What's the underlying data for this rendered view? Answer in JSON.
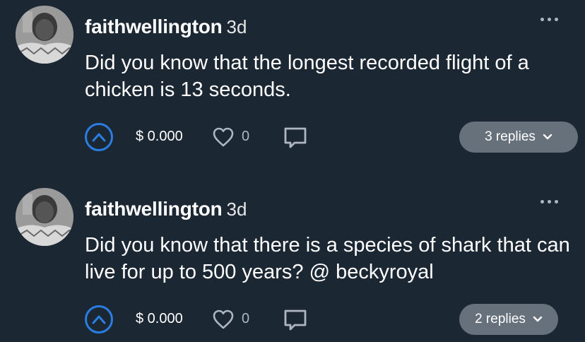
{
  "posts": [
    {
      "username": "faithwellington",
      "time": "3d",
      "text": "Did you know that the longest recorded flight of a chicken is 13 seconds.",
      "amount": "$ 0.000",
      "likes": "0",
      "replies": "3 replies",
      "icons": {
        "upvote": "chevron-up-icon",
        "like": "heart-outline-icon",
        "comment": "comment-icon",
        "more": "more-horizontal-icon",
        "replies": "chevron-down-icon"
      }
    },
    {
      "username": "faithwellington",
      "time": "3d",
      "text": "Did you know that there is a species of shark that can live for up to 500 years? @ beckyroyal",
      "amount": "$ 0.000",
      "likes": "0",
      "replies": "2 replies",
      "icons": {
        "upvote": "chevron-up-icon",
        "like": "heart-outline-icon",
        "comment": "comment-icon",
        "more": "more-horizontal-icon",
        "replies": "chevron-down-icon"
      }
    }
  ],
  "colors": {
    "background": "#1c2734",
    "accent": "#2a7de1",
    "muted": "#aeb6c0",
    "pill": "#66717c"
  }
}
